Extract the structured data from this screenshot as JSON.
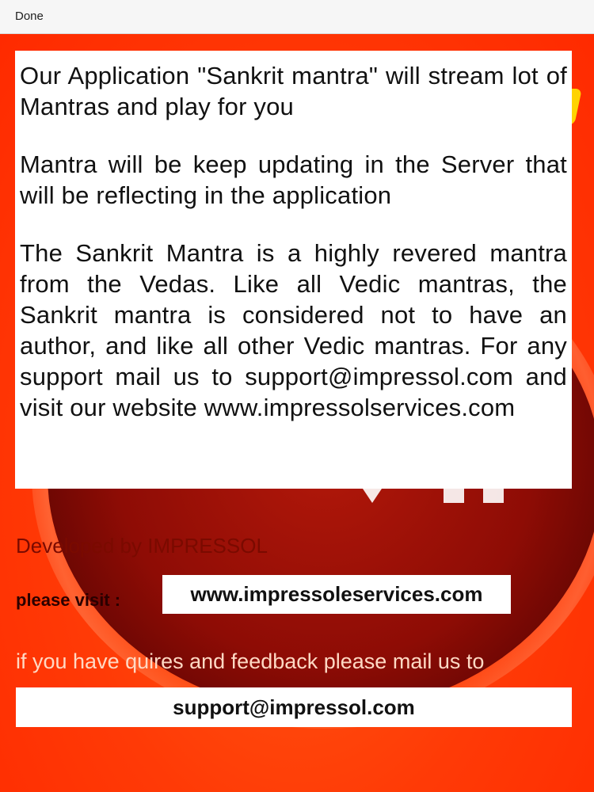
{
  "toolbar": {
    "done_label": "Done"
  },
  "info": {
    "paragraphs": [
      "Our Application \"Sankrit mantra\"  will stream lot of  Mantras and play for you",
      "Mantra will be keep updating in the  Server that will be reflecting in the application",
      "The Sankrit Mantra is a highly revered mantra from the Vedas. Like all Vedic mantras, the Sankrit mantra is considered not to have an author, and like all other Vedic mantras. For any support mail us to support@impressol.com and visit our website www.impressolservices.com"
    ]
  },
  "footer": {
    "developed_by": "Developed by IMPRESSOL",
    "visit_label": "please visit :",
    "website": "www.impressoleservices.com",
    "feedback_text": "if you have quires and feedback please mail us to",
    "email": "support@impressol.com"
  },
  "colors": {
    "background": "#ff3d0a",
    "circle": "#8e0c05",
    "accent": "#ffd300"
  }
}
